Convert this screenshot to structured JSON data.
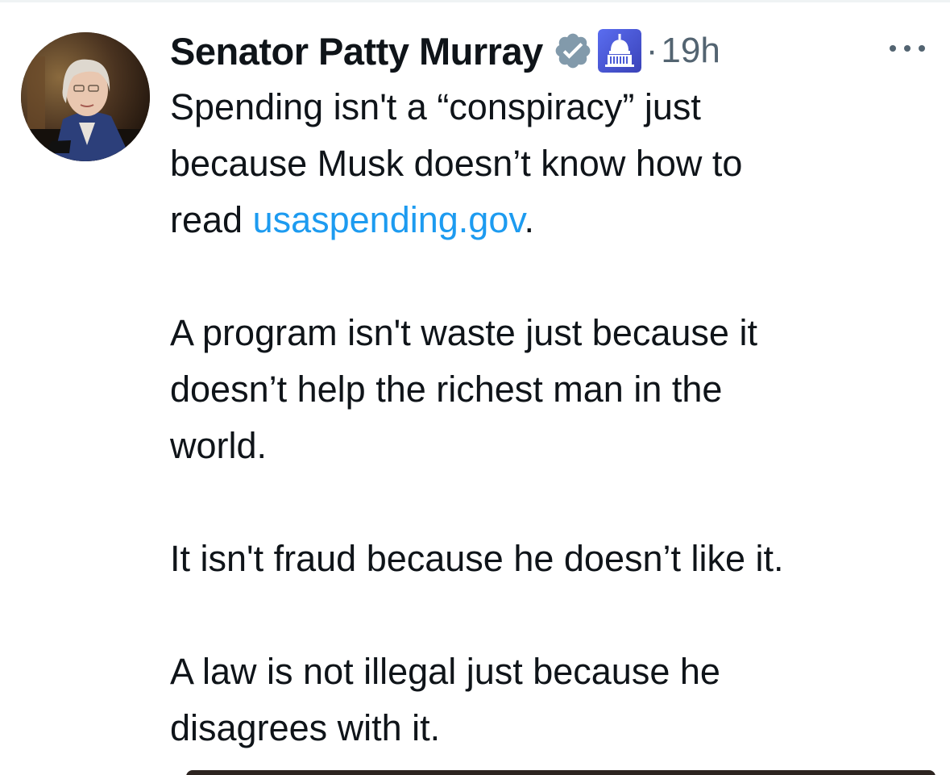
{
  "tweet": {
    "author": {
      "display_name": "Senator Patty Murray",
      "verified_icon": "verified-badge-icon",
      "affiliate_icon": "capitol-building-icon"
    },
    "separator": "·",
    "time": "19h",
    "more_icon": "more-horizontal-icon",
    "paragraphs": [
      {
        "lines": [
          "Spending isn't a “conspiracy” just",
          "because Musk doesn’t know how to"
        ],
        "last_line_prefix": "read ",
        "link_text": "usaspending.gov",
        "last_line_suffix": "."
      },
      {
        "lines": [
          "A program isn't waste just because it",
          "doesn’t help the richest man in the",
          "world."
        ]
      },
      {
        "lines": [
          "It isn't fraud because he doesn’t like it."
        ]
      },
      {
        "lines": [
          "A law is not illegal just because he",
          "disagrees with it."
        ]
      }
    ]
  },
  "colors": {
    "text": "#0f1419",
    "secondary": "#536471",
    "link": "#1d9bf0",
    "verified_badge": "#829aab",
    "affiliate_bg": "#4b5bd6"
  }
}
